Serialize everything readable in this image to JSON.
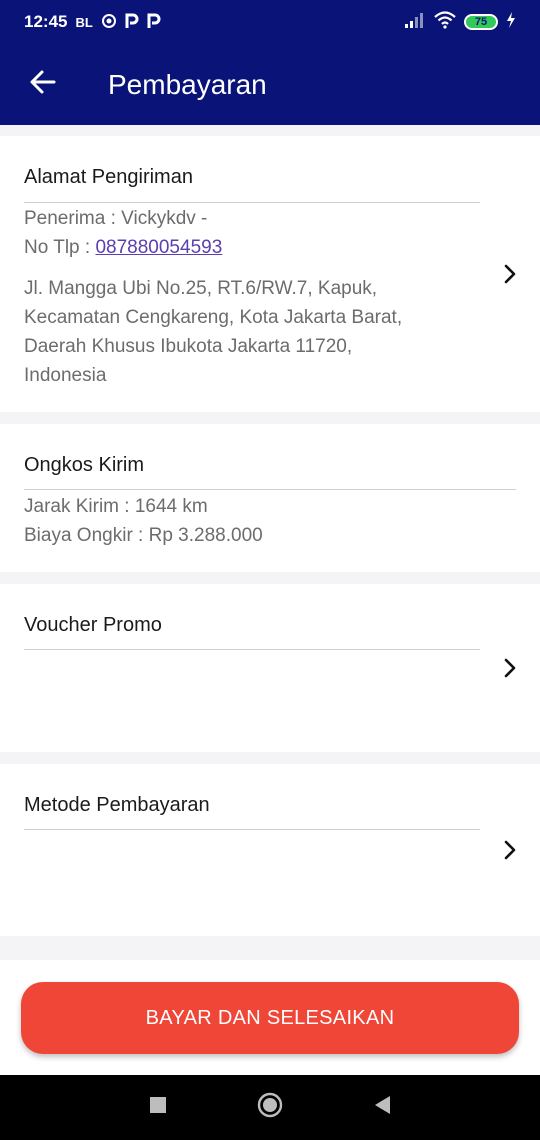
{
  "status_bar": {
    "time": "12:45",
    "carrier_tag": "BL",
    "notif_icons": [
      "sync-icon",
      "p-icon",
      "p-icon"
    ],
    "battery_level": "75",
    "icons": [
      "signal-icon",
      "wifi-icon",
      "battery-icon",
      "charging-icon"
    ]
  },
  "app_bar": {
    "title": "Pembayaran",
    "back_icon": "arrow-left-icon"
  },
  "address": {
    "title": "Alamat Pengiriman",
    "recipient_line": "Penerima : Vickykdv -",
    "phone_label": "No Tlp : ",
    "phone_number": "087880054593",
    "address_lines": [
      "Jl. Mangga Ubi No.25, RT.6/RW.7, Kapuk,",
      "Kecamatan Cengkareng, Kota Jakarta Barat,",
      "Daerah Khusus Ibukota Jakarta 11720,",
      "Indonesia"
    ]
  },
  "shipping": {
    "title": "Ongkos Kirim",
    "distance": "Jarak Kirim : 1644 km",
    "cost": "Biaya Ongkir : Rp 3.288.000"
  },
  "voucher": {
    "title": "Voucher Promo"
  },
  "payment_method": {
    "title": "Metode Pembayaran"
  },
  "action": {
    "pay_label": "BAYAR DAN SELESAIKAN",
    "color": "#ef4637"
  },
  "colors": {
    "primary": "#0a1478",
    "link": "#5a3fae"
  }
}
